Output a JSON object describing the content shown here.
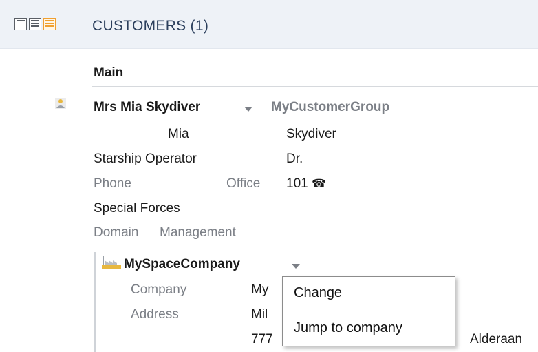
{
  "header": {
    "view_icons": [
      "compact-view-icon",
      "detail-view-icon",
      "list-view-icon"
    ],
    "title": "CUSTOMERS (1)"
  },
  "main": {
    "section_label": "Main",
    "customer": {
      "full_name": "Mrs Mia Skydiver",
      "group": "MyCustomerGroup",
      "first_name": "Mia",
      "last_name": "Skydiver",
      "job_title": "Starship Operator",
      "salutation": "Dr.",
      "phone_label": "Phone",
      "phone_type": "Office",
      "phone_value": "101",
      "phone_glyph": "☎",
      "department": "Special Forces",
      "domain_label": "Domain",
      "domain_value": "Management"
    },
    "company": {
      "name": "MySpaceCompany",
      "company_label": "Company",
      "company_value_partial": "My",
      "address_label": "Address",
      "address_line1_partial": "Mil",
      "address_line2_partial": "777",
      "address_city": "Alderaan"
    }
  },
  "context_menu": {
    "items": [
      "Change",
      "Jump to company"
    ]
  },
  "colors": {
    "header_bg": "#eef2f7",
    "accent_orange": "#f0a030",
    "label_grey": "#7b7f86"
  }
}
